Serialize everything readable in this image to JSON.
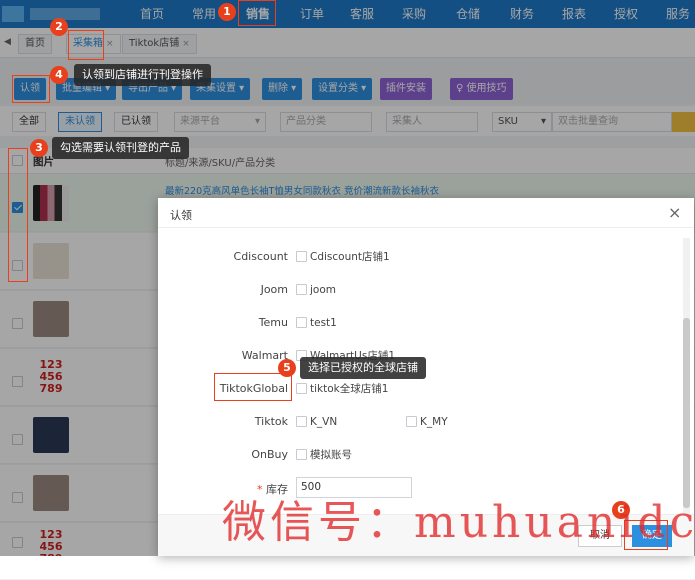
{
  "topnav": {
    "items": [
      "首页",
      "常用",
      "销售",
      "订单",
      "客服",
      "采购",
      "仓储",
      "财务",
      "报表",
      "授权",
      "服务"
    ]
  },
  "tabs": [
    "首页",
    "采集箱",
    "Tiktok店铺"
  ],
  "tab_close": "×",
  "toolbar": {
    "buttons": [
      "认领",
      "批量编辑",
      "导出产品",
      "采集设置",
      "删除",
      "设置分类",
      "插件安装",
      "使用技巧"
    ]
  },
  "filters": {
    "buttons": [
      "全部",
      "未认领",
      "已认领"
    ],
    "source_placeholder": "来源平台",
    "category_placeholder": "产品分类",
    "collector_placeholder": "采集人",
    "sku_select": "SKU",
    "search_placeholder": "双击批量查询"
  },
  "table": {
    "col_image": "图片",
    "col_info": "标题/来源/SKU/产品分类",
    "first_title": "最新220克高风单色长袖T恤男女同款秋衣 竞价潮流新款长袖秋衣",
    "thumb_text": "123\n456\n789"
  },
  "dialog": {
    "title": "认领",
    "close": "×",
    "stores": [
      {
        "label": "Cdiscount",
        "options": [
          "Cdiscount店铺1"
        ]
      },
      {
        "label": "Joom",
        "options": [
          "joom"
        ]
      },
      {
        "label": "Temu",
        "options": [
          "test1"
        ]
      },
      {
        "label": "Walmart",
        "options": [
          "WalmartUs店铺1"
        ]
      },
      {
        "label": "TiktokGlobal",
        "options": [
          "tiktok全球店铺1"
        ]
      },
      {
        "label": "Tiktok",
        "options": [
          "K_VN",
          "K_MY"
        ]
      },
      {
        "label": "OnBuy",
        "options": [
          "模拟账号"
        ]
      }
    ],
    "stock_required": "*",
    "stock_label": "库存",
    "stock_value": "500",
    "cancel": "取消",
    "confirm": "确定"
  },
  "annotations": [
    {
      "num": "1"
    },
    {
      "num": "2"
    },
    {
      "num": "3",
      "text": "勾选需要认领刊登的产品"
    },
    {
      "num": "4",
      "text": "认领到店铺进行刊登操作"
    },
    {
      "num": "5",
      "text": "选择已授权的全球店铺"
    },
    {
      "num": "6"
    }
  ],
  "watermark": "微信号：muhuanidc",
  "colors": {
    "nav": "#1f7ac9",
    "primary": "#2d8fe0",
    "annotation": "#e8401c"
  }
}
